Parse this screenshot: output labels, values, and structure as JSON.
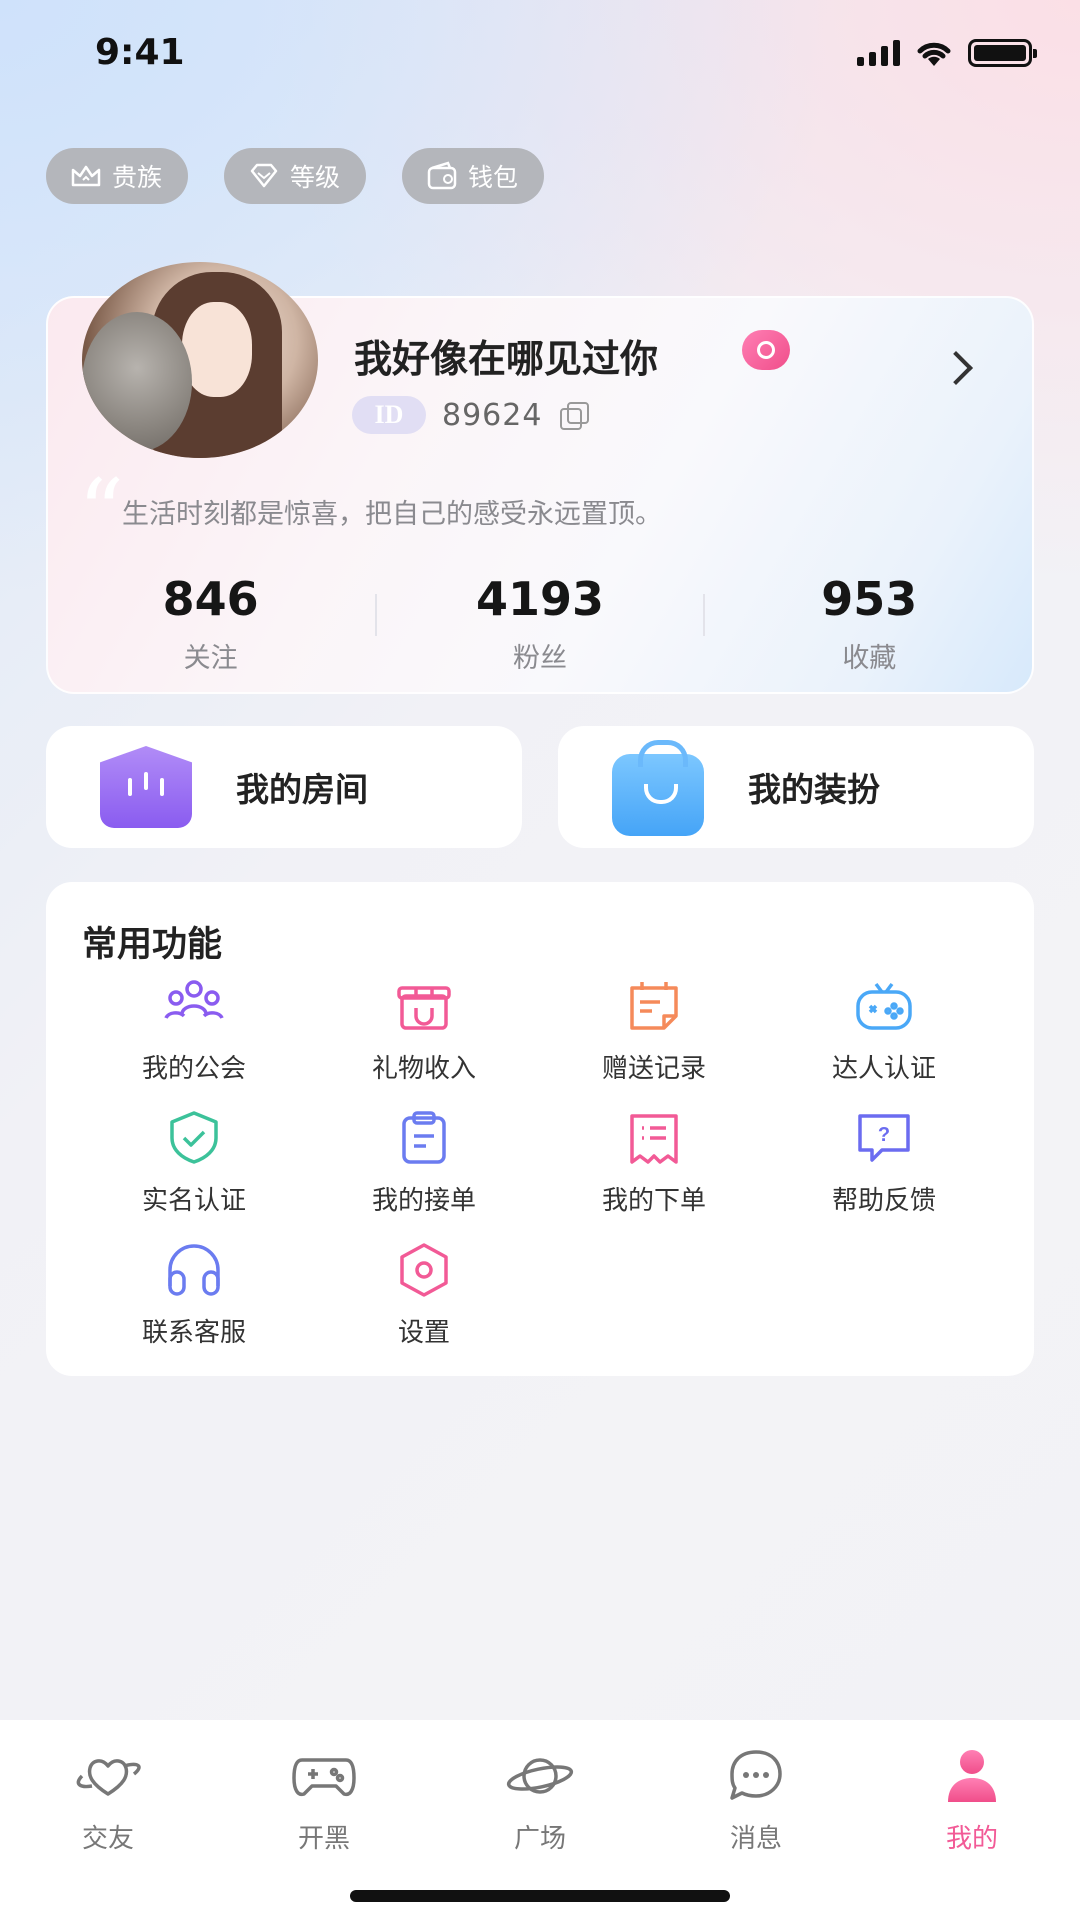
{
  "status_bar": {
    "time": "9:41"
  },
  "chips": [
    {
      "icon": "crown-icon",
      "label": "贵族"
    },
    {
      "icon": "diamond-icon",
      "label": "等级"
    },
    {
      "icon": "wallet-icon",
      "label": "钱包"
    }
  ],
  "profile": {
    "name": "我好像在哪见过你",
    "id_tag": "ID",
    "id": "89624",
    "signature": "生活时刻都是惊喜，把自己的感受永远置顶。",
    "stats": [
      {
        "value": "846",
        "label": "关注"
      },
      {
        "value": "4193",
        "label": "粉丝"
      },
      {
        "value": "953",
        "label": "收藏"
      }
    ]
  },
  "quick": {
    "room": "我的房间",
    "outfit": "我的装扮"
  },
  "functions": {
    "title": "常用功能",
    "items": [
      {
        "label": "我的公会",
        "icon": "guild-icon",
        "color": "#8a5cf0"
      },
      {
        "label": "礼物收入",
        "icon": "gift-icon",
        "color": "#f25a96"
      },
      {
        "label": "赠送记录",
        "icon": "record-icon",
        "color": "#f58a5a"
      },
      {
        "label": "达人认证",
        "icon": "gamepad-icon",
        "color": "#4aa8f7"
      },
      {
        "label": "实名认证",
        "icon": "shield-check-icon",
        "color": "#3cc29a"
      },
      {
        "label": "我的接单",
        "icon": "clipboard-icon",
        "color": "#6b7cf0"
      },
      {
        "label": "我的下单",
        "icon": "order-list-icon",
        "color": "#f25a96"
      },
      {
        "label": "帮助反馈",
        "icon": "help-bubble-icon",
        "color": "#6b6cf0"
      },
      {
        "label": "联系客服",
        "icon": "headphones-icon",
        "color": "#6b7cf0"
      },
      {
        "label": "设置",
        "icon": "settings-icon",
        "color": "#f25a96"
      }
    ]
  },
  "tabs": [
    {
      "label": "交友",
      "icon": "heart-planet-icon"
    },
    {
      "label": "开黑",
      "icon": "gamepad-icon"
    },
    {
      "label": "广场",
      "icon": "planet-icon"
    },
    {
      "label": "消息",
      "icon": "chat-icon"
    },
    {
      "label": "我的",
      "icon": "person-icon"
    }
  ],
  "active_tab_color": "#f25a96"
}
